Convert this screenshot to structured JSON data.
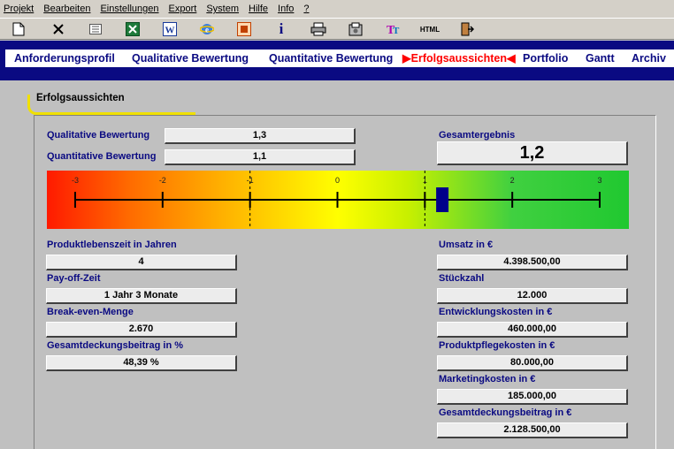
{
  "menu": [
    "Projekt",
    "Bearbeiten",
    "Einstellungen",
    "Export",
    "System",
    "Hilfe",
    "Info",
    "?"
  ],
  "toolbar": {
    "icons": [
      "new-icon",
      "delete-icon",
      "list-icon",
      "excel-icon",
      "word-icon",
      "internet-explorer-icon",
      "powerpoint-icon",
      "info-icon",
      "print-icon",
      "settings-icon",
      "font-icon",
      "html-icon",
      "exit-icon"
    ],
    "info_glyph": "i",
    "html_label": "HTML"
  },
  "nav": {
    "items": [
      "Anforderungsprofil",
      "Qualitative Bewertung",
      "Quantitative Bewertung",
      "Erfolgsaussichten",
      "Portfolio",
      "Gantt",
      "Archiv"
    ],
    "active_index": 3,
    "active_color": "#ff0000",
    "color": "#0a0a82"
  },
  "tab_title": "Erfolgsaussichten",
  "bewertung": {
    "qualitativ_label": "Qualitative Bewertung",
    "qualitativ_value": "1,3",
    "quantitativ_label": "Quantitative Bewertung",
    "quantitativ_value": "1,1",
    "gesamt_label": "Gesamtergebnis",
    "gesamt_value": "1,2"
  },
  "scale": {
    "min": -3,
    "max": 3,
    "ticks": [
      "-3",
      "-2",
      "-1",
      "0",
      "1",
      "2",
      "3"
    ],
    "threshold_low": -1,
    "threshold_high": 1,
    "marker_value": 1.2
  },
  "left_fields": [
    {
      "label": "Produktlebenszeit in Jahren",
      "value": "4"
    },
    {
      "label": "Pay-off-Zeit",
      "value": "1 Jahr 3 Monate"
    },
    {
      "label": "Break-even-Menge",
      "value": "2.670"
    },
    {
      "label": "Gesamtdeckungsbeitrag in %",
      "value": "48,39 %"
    }
  ],
  "right_fields": [
    {
      "label": "Umsatz in €",
      "value": "4.398.500,00"
    },
    {
      "label": "Stückzahl",
      "value": "12.000"
    },
    {
      "label": "Entwicklungskosten in €",
      "value": "460.000,00"
    },
    {
      "label": "Produktpflegekosten in €",
      "value": "80.000,00"
    },
    {
      "label": "Marketingkosten in €",
      "value": "185.000,00"
    },
    {
      "label": "Gesamtdeckungsbeitrag in €",
      "value": "2.128.500,00"
    }
  ]
}
